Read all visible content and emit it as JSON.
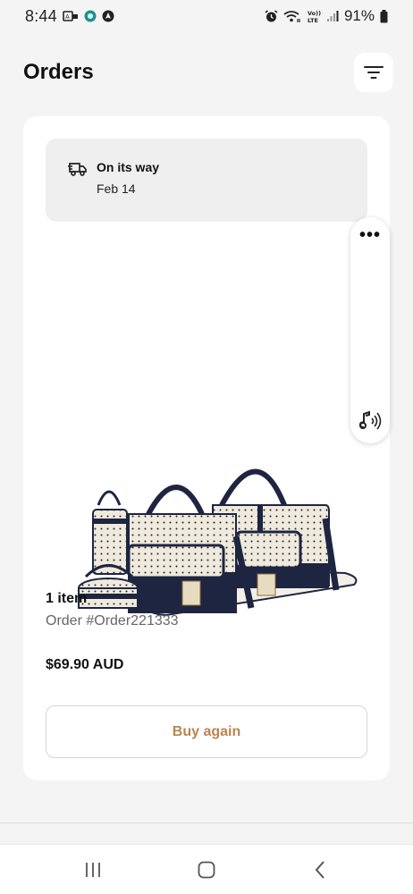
{
  "status_bar": {
    "time": "8:44",
    "battery": "91%",
    "icons": [
      "usb-debug-icon",
      "camera-app-icon",
      "navigation-app-icon",
      "alarm-icon",
      "wifi-icon",
      "volte-icon",
      "signal-icon",
      "battery-icon"
    ],
    "volte_label": "Vo))\nLTE"
  },
  "header": {
    "title": "Orders",
    "filter_icon": "filter-icon"
  },
  "order": {
    "status_title": "On its way",
    "status_date": "Feb 14",
    "status_icon": "delivery-truck-icon",
    "item_count": "1 item",
    "order_number": "Order #Order221333",
    "price": "$69.90 AUD",
    "buy_again_label": "Buy again",
    "accent_color": "#b98550"
  },
  "side_panel": {
    "more_label": "•••",
    "sound_icon": "music-sound-icon"
  },
  "nav": {
    "recent_icon": "recent-apps-icon",
    "home_icon": "home-icon",
    "back_icon": "back-icon"
  }
}
